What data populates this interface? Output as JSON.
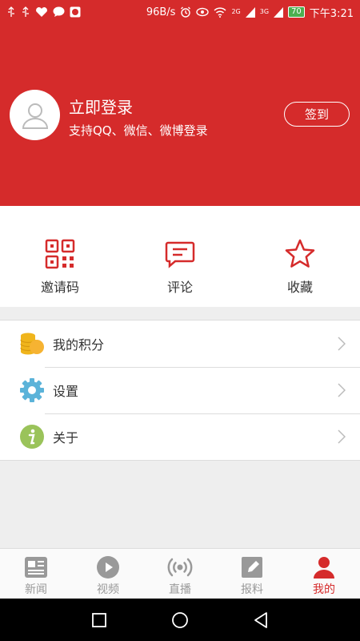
{
  "status_bar": {
    "speed": "96B/s",
    "network_2g": "2G",
    "network_3g": "3G",
    "battery": "70",
    "time": "下午3:21"
  },
  "header": {
    "login_title": "立即登录",
    "login_subtitle": "支持QQ、微信、微博登录",
    "signin_button": "签到",
    "background_color": "#d52b2b"
  },
  "quick_actions": [
    {
      "label": "邀请码",
      "icon": "qr-code-icon"
    },
    {
      "label": "评论",
      "icon": "comment-icon"
    },
    {
      "label": "收藏",
      "icon": "star-icon"
    }
  ],
  "menu": [
    {
      "label": "我的积分",
      "icon": "coins-icon"
    },
    {
      "label": "设置",
      "icon": "gear-icon"
    },
    {
      "label": "关于",
      "icon": "info-icon"
    }
  ],
  "bottom_nav": [
    {
      "label": "新闻",
      "icon": "news-icon",
      "active": false
    },
    {
      "label": "视频",
      "icon": "play-icon",
      "active": false
    },
    {
      "label": "直播",
      "icon": "broadcast-icon",
      "active": false
    },
    {
      "label": "报料",
      "icon": "edit-icon",
      "active": false
    },
    {
      "label": "我的",
      "icon": "person-icon",
      "active": true
    }
  ],
  "accent_color": "#d52b2b"
}
